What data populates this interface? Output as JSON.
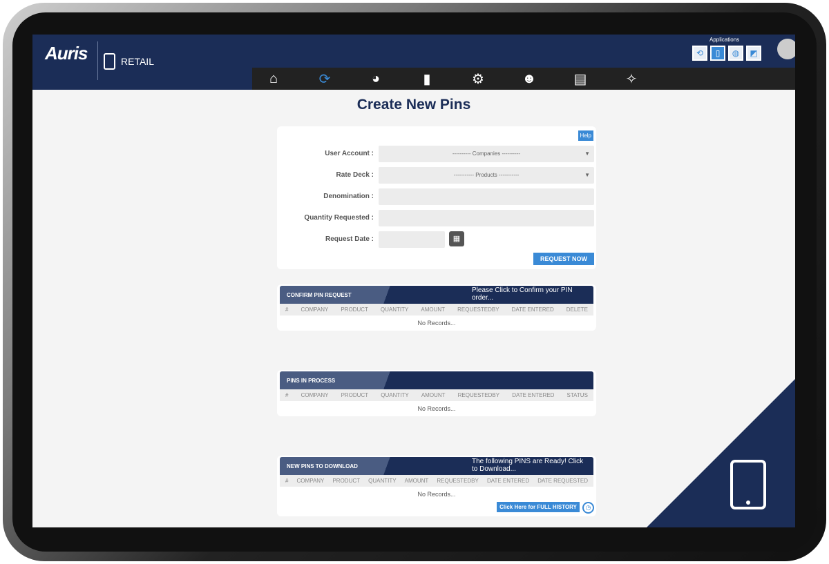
{
  "header": {
    "logo": "Auris",
    "module": "RETAIL",
    "apps_label": "Applications",
    "apps": [
      "⟲",
      "▯",
      "◍",
      "◩"
    ]
  },
  "nav": [
    {
      "icon": "home-icon",
      "glyph": "⌂"
    },
    {
      "icon": "refresh-icon",
      "glyph": "⟳"
    },
    {
      "icon": "pie-chart-icon",
      "glyph": "◕"
    },
    {
      "icon": "document-icon",
      "glyph": "▮"
    },
    {
      "icon": "gear-icon",
      "glyph": "⚙"
    },
    {
      "icon": "support-icon",
      "glyph": "☻"
    },
    {
      "icon": "clipboard-icon",
      "glyph": "▤"
    },
    {
      "icon": "crosshair-icon",
      "glyph": "✧"
    }
  ],
  "title": "Create New Pins",
  "form": {
    "help": "Help",
    "user_account_label": "User Account :",
    "user_account_value": "---------- Companies ----------",
    "rate_deck_label": "Rate Deck :",
    "rate_deck_value": "----------- Products -----------",
    "denomination_label": "Denomination :",
    "quantity_label": "Quantity Requested :",
    "date_label": "Request Date :",
    "submit": "REQUEST NOW"
  },
  "confirm": {
    "title": "CONFIRM PIN REQUEST",
    "note": "Please Click to Confirm your PIN order...",
    "columns": [
      "#",
      "COMPANY",
      "PRODUCT",
      "QUANTITY",
      "AMOUNT",
      "REQUESTEDBY",
      "DATE ENTERED",
      "DELETE"
    ],
    "empty": "No Records..."
  },
  "process": {
    "title": "PINS IN PROCESS",
    "columns": [
      "#",
      "COMPANY",
      "PRODUCT",
      "QUANTITY",
      "AMOUNT",
      "REQUESTEDBY",
      "DATE ENTERED",
      "STATUS"
    ],
    "empty": "No Records..."
  },
  "download": {
    "title": "NEW PINS TO DOWNLOAD",
    "note": "The following PINS are Ready! Click to Download...",
    "columns": [
      "#",
      "COMPANY",
      "PRODUCT",
      "QUANTITY",
      "AMOUNT",
      "REQUESTEDBY",
      "DATE ENTERED",
      "DATE REQUESTED"
    ],
    "empty": "No Records...",
    "history": "Click Here for FULL HISTORY"
  }
}
